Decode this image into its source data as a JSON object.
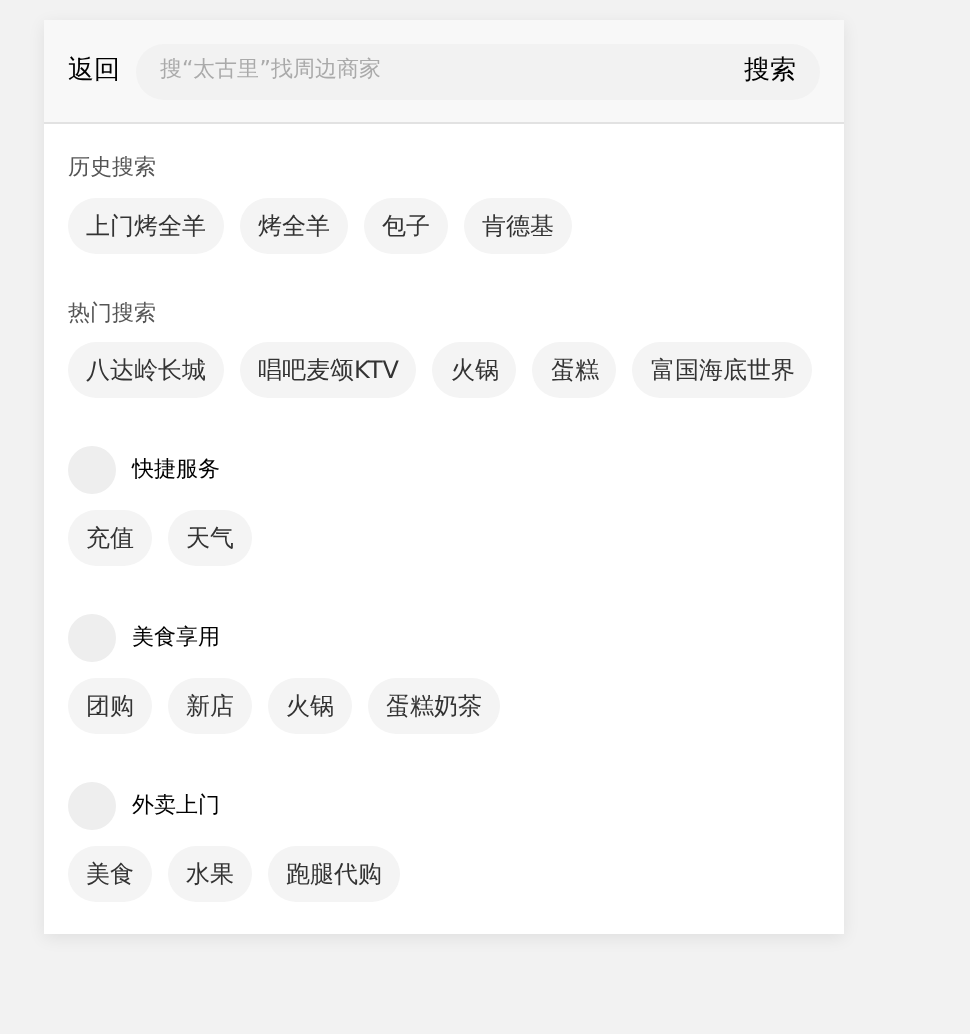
{
  "header": {
    "back": "返回",
    "search": {
      "placeholder": "搜“太古里”找周边商家"
    },
    "search_button": "搜索"
  },
  "history": {
    "title": "历史搜索",
    "tags": [
      "上门烤全羊",
      "烤全羊",
      "包子",
      "肯德基"
    ]
  },
  "hot": {
    "title": "热门搜索",
    "tags": [
      "八达岭长城",
      "唱吧麦颂KTV",
      "火锅",
      "蛋糕",
      "富国海底世界"
    ]
  },
  "services": [
    {
      "title": "快捷服务",
      "tags": [
        "充值",
        "天气"
      ]
    },
    {
      "title": "美食享用",
      "tags": [
        "团购",
        "新店",
        "火锅",
        "蛋糕奶茶"
      ]
    },
    {
      "title": "外卖上门",
      "tags": [
        "美食",
        "水果",
        "跑腿代购"
      ]
    }
  ]
}
